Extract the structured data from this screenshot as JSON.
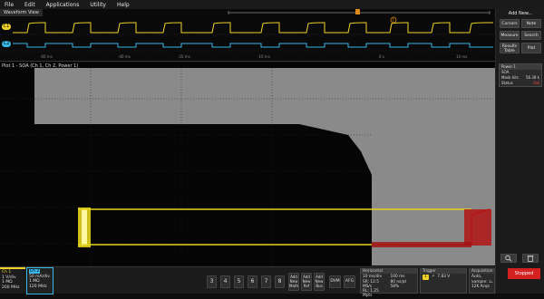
{
  "menu": [
    "File",
    "Edit",
    "Applications",
    "Utility",
    "Help"
  ],
  "waveform_view": {
    "title": "Waveform View",
    "ch1_tag": "C1",
    "ch2_tag": "C2",
    "time_labels": [
      "-60 ms",
      "-40 ms",
      "-20 ms",
      "-10 ms",
      "0 s",
      "10 ms"
    ],
    "colors": {
      "ch1": "#f0d22a",
      "ch2": "#3ab7e8",
      "cursor": "#e08a1a"
    }
  },
  "right_panel": {
    "add_new": "Add New...",
    "buttons": [
      "Cursors",
      "Note",
      "Measure",
      "Search",
      "Results Table",
      "Plot"
    ],
    "power_card": {
      "title": "Power 1",
      "name": "SOA",
      "mask_hits_label": "Mask hits",
      "mask_hits_value": "56.39 k",
      "status_label": "Status",
      "status_value": "Fail"
    },
    "stopped_label": "Stopped"
  },
  "plot": {
    "title": "Plot 1 - SOA (Ch 1, Ch 2, Power 1)",
    "colors": {
      "mask": "#8a8a8a",
      "pass_trace": "#e6d41e",
      "fail_trace": "#d01818"
    }
  },
  "bottom_bar": {
    "ch1": {
      "name": "Ch 1",
      "lines": [
        "1 V/div",
        "1 MΩ",
        "200 MHz"
      ]
    },
    "ch2": {
      "name": "Ch 2",
      "lines": [
        "50 mA/div",
        "1 MΩ",
        "120 MHz"
      ]
    },
    "num_buttons": [
      "3",
      "4",
      "5",
      "6",
      "7",
      "8"
    ],
    "add_buttons": [
      {
        "l1": "Add",
        "l2": "New",
        "l3": "Math"
      },
      {
        "l1": "Add",
        "l2": "New",
        "l3": "Ref"
      },
      {
        "l1": "Add",
        "l2": "New",
        "l3": "Bus"
      }
    ],
    "dvm": "DVM",
    "afg": "AFG",
    "horizontal": {
      "title": "Horizontal",
      "c1": [
        "10 ms/div",
        "SR: 12.5 MS/s",
        "RL: 1.25 Mpts"
      ],
      "c2": [
        "100 ms",
        "80 ns/pt",
        "58%"
      ]
    },
    "trigger": {
      "title": "Trigger",
      "badge": "1",
      "value": "7.83 V",
      "level": "Level"
    },
    "acquisition": {
      "title": "Acquisition",
      "c1": [
        "Auto,",
        "Sample: 12 bits",
        "12K Acqs"
      ],
      "c2": [
        "Analyze"
      ]
    }
  }
}
